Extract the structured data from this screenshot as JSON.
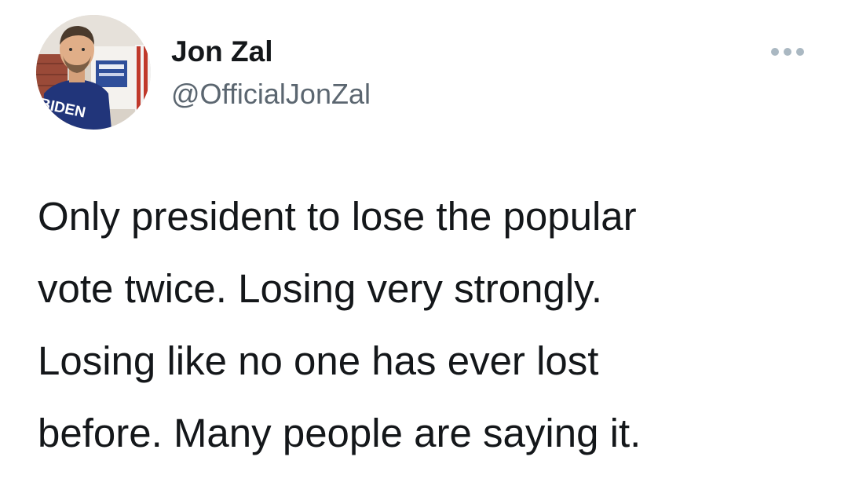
{
  "tweet": {
    "author": {
      "display_name": "Jon Zal",
      "handle": "@OfficialJonZal",
      "avatar_shirt_text": "BIDEN"
    },
    "more_icon": "more-horizontal-icon",
    "text_lines": [
      "Only president to lose the popular",
      "vote twice. Losing very strongly.",
      "Losing like no one has ever lost",
      "before. Many people are saying it."
    ]
  },
  "colors": {
    "text": "#14171a",
    "secondary_text": "#5b6670",
    "icon_gray": "#aab8c2",
    "background": "#ffffff"
  }
}
